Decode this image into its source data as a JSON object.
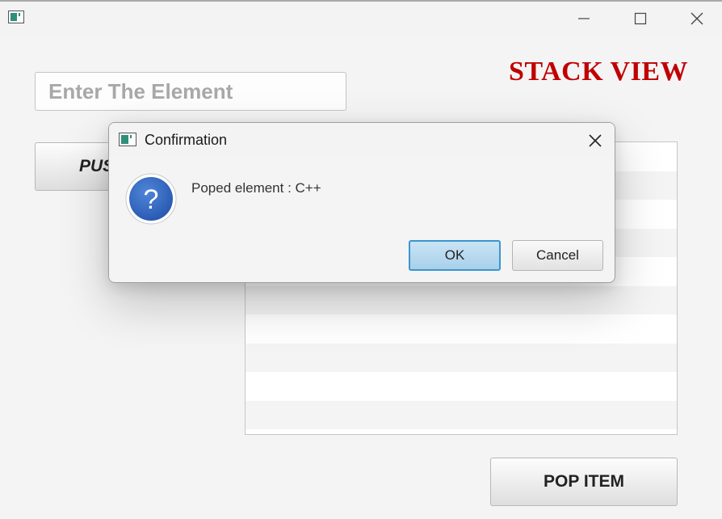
{
  "window": {
    "minimize_icon": "minimize-icon",
    "maximize_icon": "maximize-icon",
    "close_icon": "close-icon"
  },
  "main": {
    "title": "STACK VIEW",
    "title_color": "#c00000",
    "input_placeholder": "Enter The Element",
    "input_value": "",
    "push_button_label": "PUSH ITEM",
    "pop_button_label": "POP ITEM",
    "stack_items": []
  },
  "dialog": {
    "title": "Confirmation",
    "message": "Poped element : C++",
    "icon": "question-icon",
    "ok_label": "OK",
    "cancel_label": "Cancel",
    "accent_color": "#3a96cf"
  }
}
